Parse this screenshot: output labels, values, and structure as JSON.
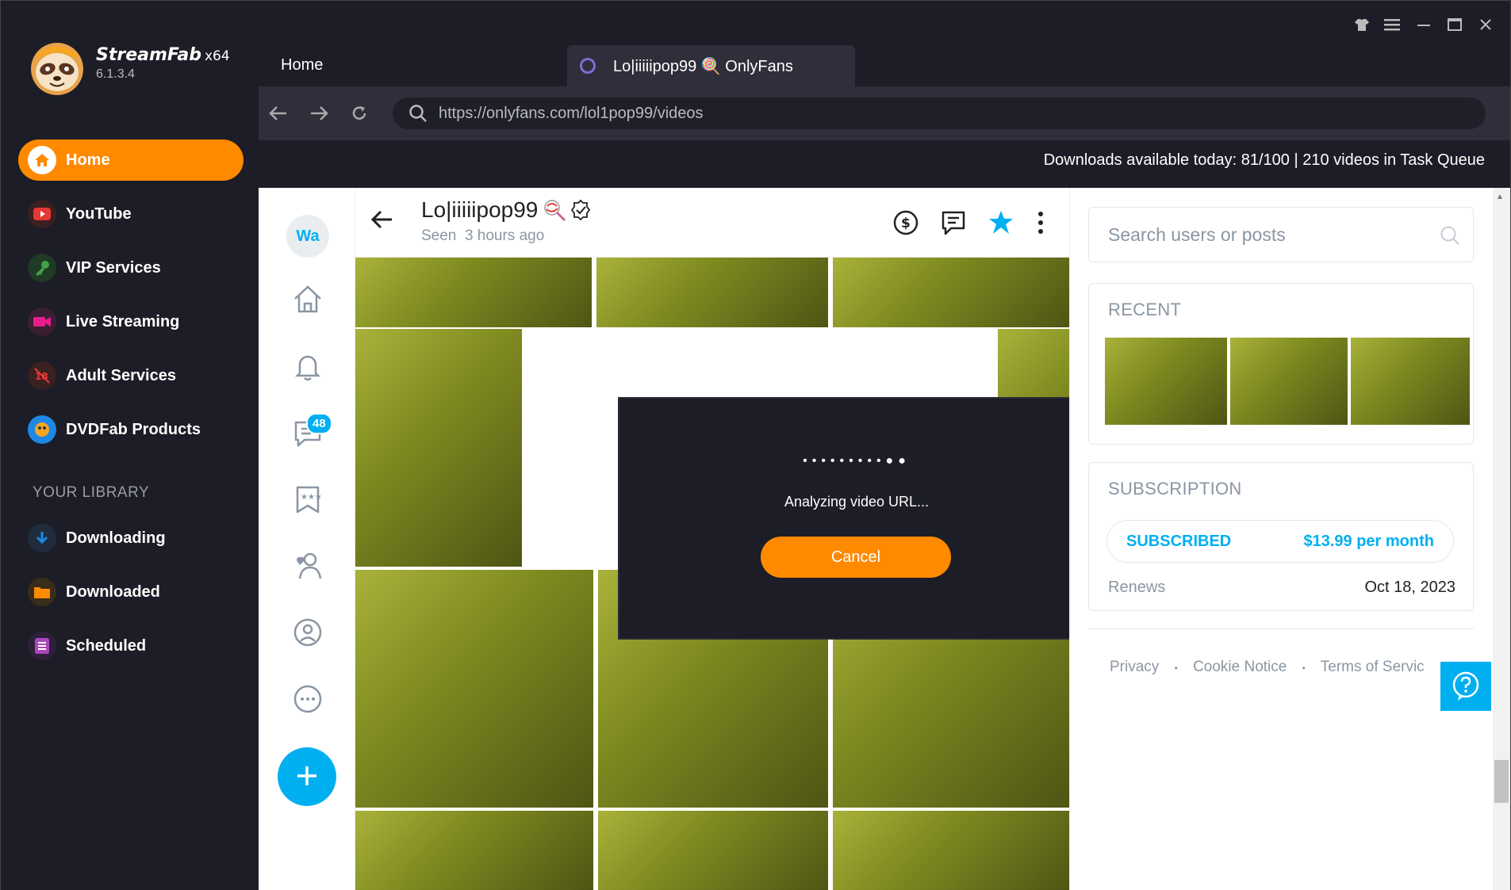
{
  "app": {
    "name": "StreamFab",
    "arch": "x64",
    "version": "6.1.3.4"
  },
  "sidebar": {
    "items": [
      {
        "label": "Home",
        "icon": "home-icon",
        "color": "#ff8a00"
      },
      {
        "label": "YouTube",
        "icon": "youtube-icon",
        "color": "#e53935"
      },
      {
        "label": "VIP Services",
        "icon": "key-icon",
        "color": "#2e7d32"
      },
      {
        "label": "Live Streaming",
        "icon": "camera-icon",
        "color": "#d81b9a"
      },
      {
        "label": "Adult Services",
        "icon": "adult-icon",
        "color": "#e53935"
      },
      {
        "label": "DVDFab Products",
        "icon": "dvdfab-icon",
        "color": "#1e88e5"
      }
    ],
    "library_heading": "YOUR LIBRARY",
    "library": [
      {
        "label": "Downloading",
        "icon": "download-icon",
        "color": "#1e88e5"
      },
      {
        "label": "Downloaded",
        "icon": "folder-icon",
        "color": "#fb8c00"
      },
      {
        "label": "Scheduled",
        "icon": "list-icon",
        "color": "#8e24aa"
      }
    ]
  },
  "tabs": {
    "home": "Home",
    "active": "Lo|iiiiipop99 🍭 OnlyFans"
  },
  "url": "https://onlyfans.com/lol1pop99/videos",
  "status": "Downloads available today: 81/100 | 210 videos in Task Queue",
  "onlyfans": {
    "avatar": "Wa",
    "messages_badge": "48",
    "profile_name": "Lo|iiiiipop99",
    "seen_label": "Seen",
    "seen_time": "3 hours ago",
    "search_placeholder": "Search users or posts",
    "recent_title": "RECENT",
    "subscription_title": "SUBSCRIPTION",
    "subscribed_label": "SUBSCRIBED",
    "price": "$13.99 per month",
    "renews_label": "Renews",
    "renews_date": "Oct 18, 2023",
    "footer": {
      "privacy": "Privacy",
      "sep": "•",
      "cookie": "Cookie Notice",
      "terms": "Terms of Servic"
    }
  },
  "modal": {
    "dots": "•••••••••●●",
    "message": "Analyzing video URL...",
    "cancel": "Cancel"
  },
  "colors": {
    "accent": "#ff8a00",
    "onlyfans": "#00aff0"
  }
}
